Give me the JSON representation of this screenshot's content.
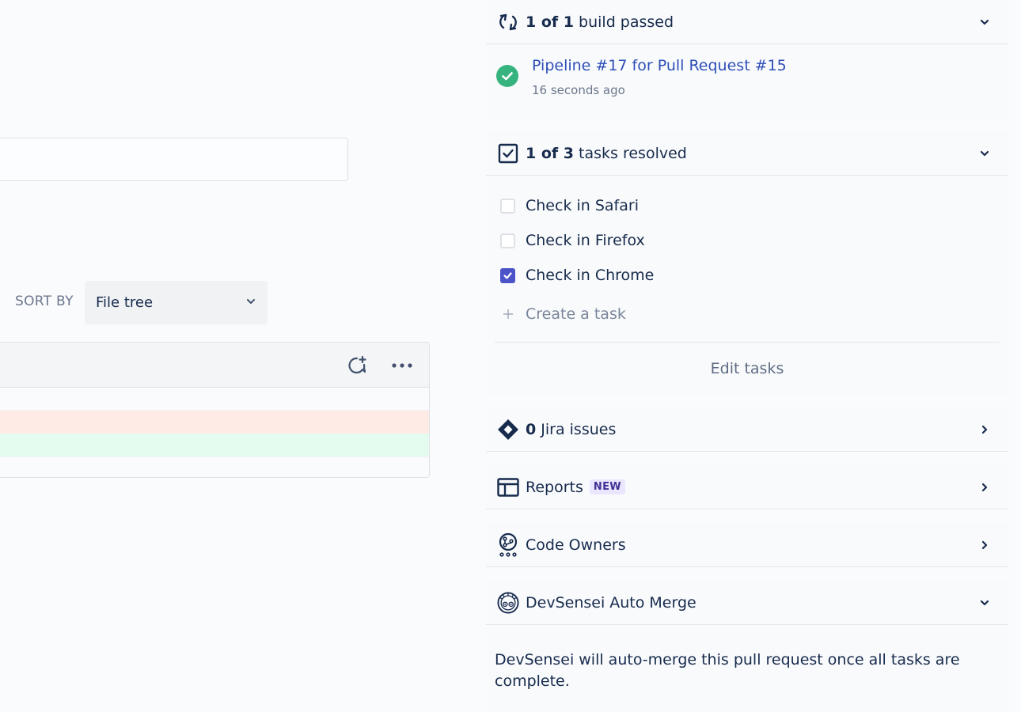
{
  "sort": {
    "label": "SORT BY",
    "selected": "File tree"
  },
  "builds": {
    "count_bold": "1 of 1",
    "title_rest": " build passed",
    "pipeline_link": "Pipeline #17 for Pull Request #15",
    "time": "16 seconds ago",
    "status_color": "#36b37e"
  },
  "tasks": {
    "count_bold": "1 of 3",
    "title_rest": " tasks resolved",
    "items": [
      {
        "label": "Check in Safari",
        "checked": false
      },
      {
        "label": "Check in Firefox",
        "checked": false
      },
      {
        "label": "Check in Chrome",
        "checked": true
      }
    ],
    "create_placeholder": "Create a task",
    "edit_label": "Edit tasks"
  },
  "jira": {
    "count_bold": "0",
    "title_rest": " Jira issues"
  },
  "reports": {
    "title": "Reports",
    "badge": "NEW"
  },
  "code_owners": {
    "title": "Code Owners"
  },
  "devsensei": {
    "title": "DevSensei Auto Merge",
    "description": "DevSensei will auto-merge this pull request once all tasks are complete."
  },
  "colors": {
    "accent": "#4c52c8",
    "link": "#2e4fb8",
    "removed_row": "#ffebe6",
    "added_row": "#e3fcef"
  }
}
